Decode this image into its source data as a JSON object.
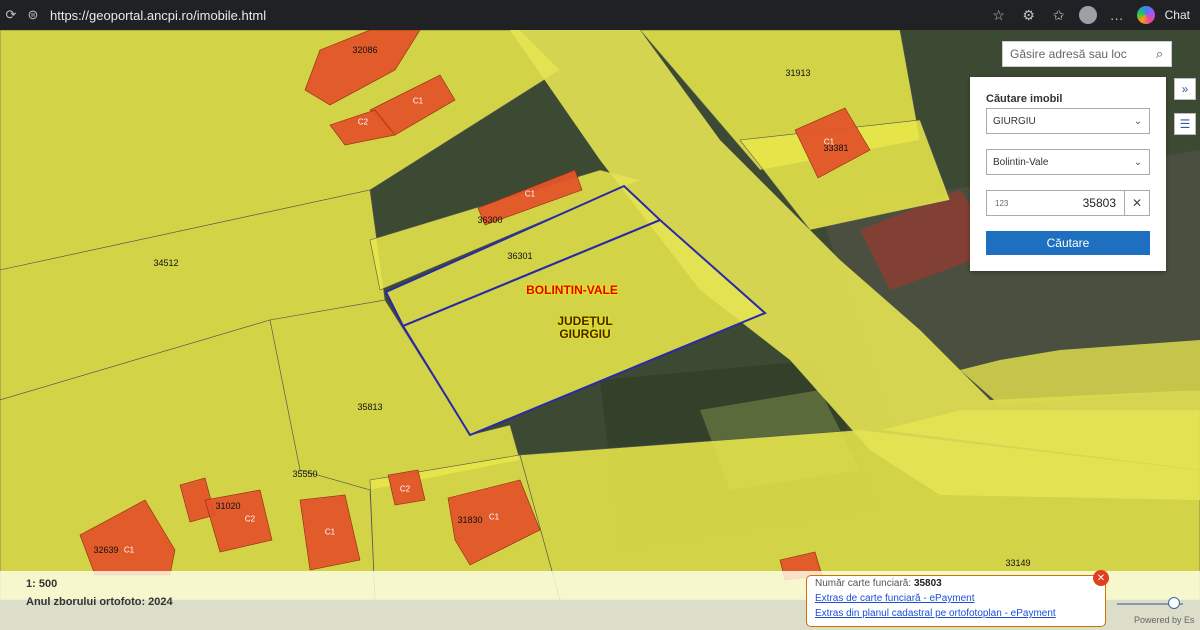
{
  "browser": {
    "url_prefix": "https://",
    "url_host": "geoportal.ancpi.ro",
    "url_path": "/imobile.html",
    "chat_label": "Chat"
  },
  "map": {
    "parcels": [
      "32086",
      "31913",
      "33381",
      "36300",
      "36301",
      "34512",
      "35813",
      "35550",
      "31020",
      "31830",
      "32639",
      "33149"
    ],
    "buildings": [
      "C1",
      "C2",
      "C1",
      "C1",
      "C2",
      "C1",
      "C1",
      "C1",
      "C2",
      "C1"
    ],
    "locality": "BOLINTIN-VALE",
    "county_line1": "JUDEȚUL",
    "county_line2": "GIURGIU"
  },
  "search": {
    "placeholder": "Găsire adresă sau loc"
  },
  "panel": {
    "title": "Căutare imobil",
    "county": "GIURGIU",
    "locality": "Bolintin-Vale",
    "number_hint": "123",
    "number_value": "35803",
    "clear": "✕",
    "search_button": "Căutare"
  },
  "footer": {
    "scale": "1: 500",
    "ortho_year": "Anul zborului ortofoto: 2024",
    "powered": "Powered by Es"
  },
  "info": {
    "label": "Număr carte funciară:",
    "number": "35803",
    "link1": "Extras de carte funciară - ePayment",
    "link2": "Extras din planul cadastral pe ortofotoplan - ePayment"
  },
  "colors": {
    "parcel": "#e7e64a",
    "building": "#e2542a",
    "selection": "#2a2aa8",
    "button": "#1e6fbf"
  }
}
